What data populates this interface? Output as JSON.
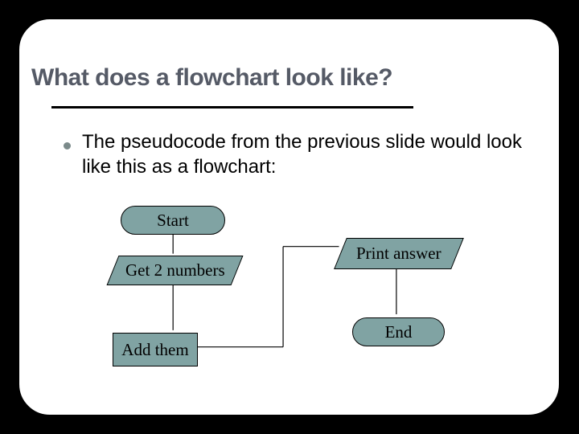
{
  "title": "What does a flowchart look like?",
  "bullet": "The pseudocode from the previous slide would look like this as a flowchart:",
  "flow": {
    "start": "Start",
    "input": "Get 2 numbers",
    "process": "Add them",
    "output": "Print answer",
    "end": "End"
  },
  "diagram": {
    "type": "flowchart",
    "nodes": [
      {
        "id": "start",
        "shape": "terminator",
        "label": "Start"
      },
      {
        "id": "input",
        "shape": "io",
        "label": "Get 2 numbers"
      },
      {
        "id": "process",
        "shape": "process",
        "label": "Add them"
      },
      {
        "id": "output",
        "shape": "io",
        "label": "Print answer"
      },
      {
        "id": "end",
        "shape": "terminator",
        "label": "End"
      }
    ],
    "edges": [
      [
        "start",
        "input"
      ],
      [
        "input",
        "process"
      ],
      [
        "process",
        "output"
      ],
      [
        "output",
        "end"
      ]
    ]
  },
  "colors": {
    "shape_fill": "#80a3a3",
    "title": "#555a66"
  }
}
